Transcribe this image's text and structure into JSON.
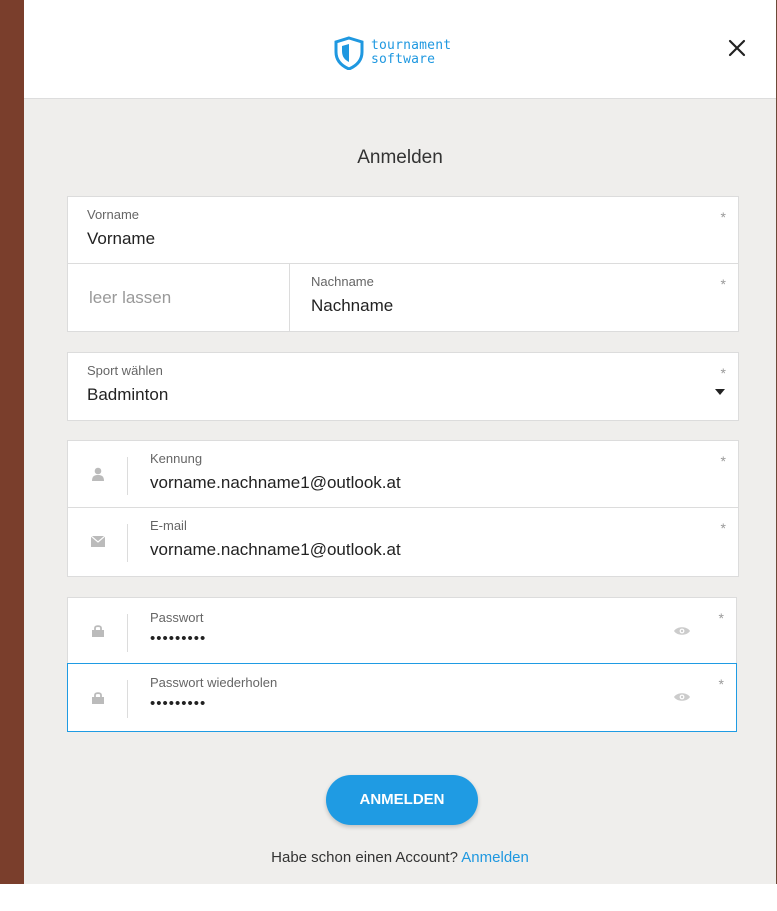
{
  "header": {
    "logo_line1": "tournament",
    "logo_line2": "software",
    "close_label": "×"
  },
  "title": "Anmelden",
  "name_group": {
    "first_name_label": "Vorname",
    "first_name_value": "Vorname",
    "middle_placeholder": "leer lassen",
    "last_name_label": "Nachname",
    "last_name_value": "Nachname",
    "required_mark": "*"
  },
  "sport": {
    "label": "Sport wählen",
    "value": "Badminton"
  },
  "account": {
    "username_label": "Kennung",
    "username_value": "vorname.nachname1@outlook.at",
    "email_label": "E-mail",
    "email_value": "vorname.nachname1@outlook.at"
  },
  "passwords": {
    "password_label": "Passwort",
    "password_value": "•••••••••",
    "repeat_label": "Passwort wiederholen",
    "repeat_value": "•••••••••"
  },
  "submit_label": "ANMELDEN",
  "footer": {
    "text": "Habe schon einen Account?",
    "link": "Anmelden"
  },
  "colors": {
    "accent": "#1f9be3",
    "modal_bg": "#efeeec"
  },
  "icons": [
    "shield-logo-icon",
    "close-icon",
    "user-icon",
    "envelope-icon",
    "lock-icon",
    "eye-icon",
    "caret-down-icon"
  ]
}
